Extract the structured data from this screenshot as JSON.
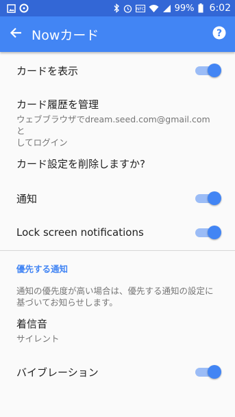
{
  "status_bar": {
    "battery_percent": "99%",
    "time": "6:02",
    "icons": [
      "image-icon",
      "circle-app-icon",
      "bluetooth-icon",
      "alarm-icon",
      "nfc-icon",
      "wifi-icon",
      "signal-icon",
      "battery-icon"
    ]
  },
  "app_bar": {
    "title": "Nowカード",
    "back_icon": "arrow-back-icon",
    "help_icon": "help-icon"
  },
  "settings": {
    "show_cards": {
      "label": "カードを表示",
      "enabled": true
    },
    "manage_history": {
      "label": "カード履歴を管理",
      "subtitle_line1": "ウェブブラウザでdream.seed.com@gmail.comと",
      "subtitle_line2": "してログイン"
    },
    "delete_settings": {
      "label": "カード設定を削除しますか?"
    },
    "notifications": {
      "label": "通知",
      "enabled": true
    },
    "lock_screen": {
      "label": "Lock screen notifications",
      "enabled": true
    }
  },
  "priority_section": {
    "header": "優先する通知",
    "description_line1": "通知の優先度が高い場合は、優先する通知の設定に",
    "description_line2": "基づいてお知らせします。",
    "ringtone": {
      "label": "着信音",
      "value": "サイレント"
    },
    "vibration": {
      "label": "バイブレーション",
      "enabled": true
    }
  },
  "colors": {
    "status_bar": "#3367d6",
    "app_bar": "#4285f4",
    "accent": "#4285f4",
    "toggle_track": "#9bbcf6"
  }
}
